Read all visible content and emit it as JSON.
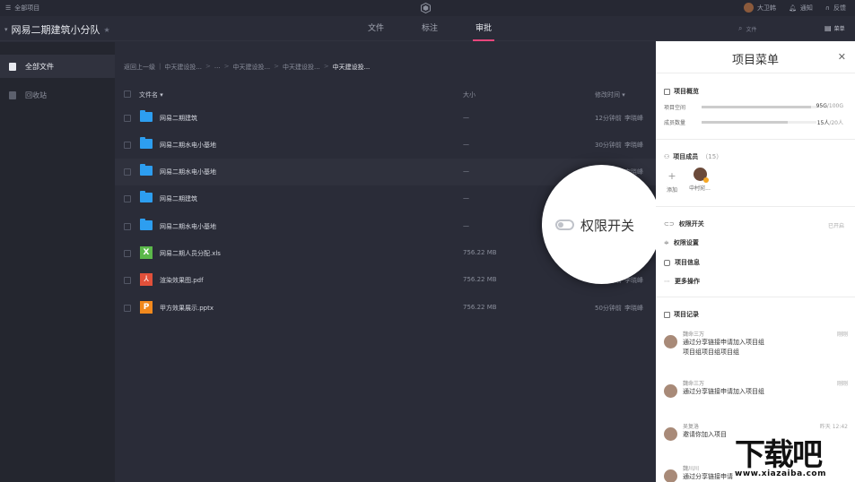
{
  "topbar": {
    "all_projects": "全部项目",
    "user_name": "大卫韩",
    "notify": "通知",
    "feedback": "反馈"
  },
  "project": {
    "name": "网易二期建筑小分队",
    "tabs": [
      "文件",
      "标注",
      "审批"
    ],
    "active_tab": "审批",
    "search_placeholder": "文件",
    "menu_label": "菜单"
  },
  "sidebar": {
    "items": [
      {
        "label": "全部文件",
        "active": true
      },
      {
        "label": "回收站",
        "active": false
      }
    ]
  },
  "breadcrumb": {
    "back": "返回上一级",
    "parts": [
      "中天建设投...",
      "...",
      "中天建设投...",
      "中天建设投..."
    ],
    "current": "中天建设投..."
  },
  "table": {
    "headers": {
      "name": "文件名",
      "size": "大小",
      "time": "修改时间"
    },
    "rows": [
      {
        "name": "网易二期建筑",
        "type": "folder",
        "size": "—",
        "time": "12分钟前",
        "user": "李晓峰"
      },
      {
        "name": "网易二期水电小基地",
        "type": "folder",
        "size": "—",
        "time": "30分钟前",
        "user": "李晓峰"
      },
      {
        "name": "网易二期水电小基地",
        "type": "folder",
        "size": "—",
        "time": "",
        "user": "李晓峰"
      },
      {
        "name": "网易二期建筑",
        "type": "folder",
        "size": "—",
        "time": "",
        "user": ""
      },
      {
        "name": "网易二期水电小基地",
        "type": "folder",
        "size": "—",
        "time": "",
        "user": ""
      },
      {
        "name": "网易二期人员分配.xls",
        "type": "xls",
        "size": "756.22 MB",
        "time": "",
        "user": ""
      },
      {
        "name": "渲染效果图.pdf",
        "type": "pdf",
        "size": "756.22 MB",
        "time": "50分钟前",
        "user": "李晓峰"
      },
      {
        "name": "甲方效果展示.pptx",
        "type": "pptx",
        "size": "756.22 MB",
        "time": "50分钟前",
        "user": "李晓峰"
      }
    ]
  },
  "magnifier": {
    "label": "权限开关"
  },
  "panel": {
    "title": "项目菜单",
    "overview": {
      "title": "项目概览",
      "space_label": "项目空间",
      "space_used": "95G",
      "space_total": "/100G",
      "space_fraction": 0.95,
      "members_label": "成员数量",
      "members_used": "15人",
      "members_total": "/20人",
      "members_fraction": 0.75
    },
    "members": {
      "title": "项目成员",
      "count": "（15）",
      "add_label": "添加",
      "member_name": "中村宛..."
    },
    "menu_items": [
      {
        "label": "权限开关",
        "status": "已开启"
      },
      {
        "label": "权限设置"
      },
      {
        "label": "项目信息"
      },
      {
        "label": "更多操作"
      }
    ],
    "records": {
      "title": "项目记录",
      "items": [
        {
          "user": "魏命三万",
          "time": "刚刚",
          "lines": [
            "通过分享链接申请加入项目组",
            "项目组项目组项目组"
          ]
        },
        {
          "user": "魏命三万",
          "time": "刚刚",
          "lines": [
            "通过分享链接申请加入项目组"
          ]
        },
        {
          "user": "吴复洛",
          "time": "昨天 12:42",
          "lines": [
            "邀请你加入项目"
          ]
        },
        {
          "user": "魏川川",
          "time": "",
          "lines": [
            "通过分享链接申请"
          ]
        }
      ]
    }
  },
  "watermark": {
    "text": "下载吧",
    "url": "www.xiazaiba.com"
  },
  "colors": {
    "accent": "#e8467c",
    "folder": "#2d9ef0",
    "xls": "#5bb84a",
    "pdf": "#e1503a",
    "pptx": "#f2891d"
  }
}
